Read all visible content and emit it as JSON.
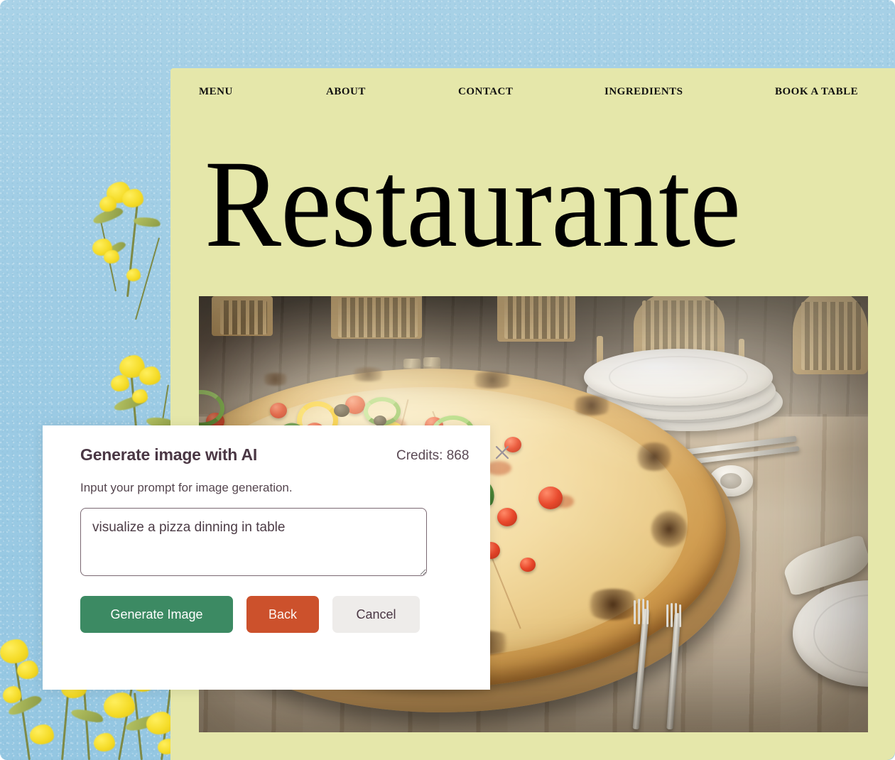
{
  "site": {
    "nav": [
      {
        "label": "MENU"
      },
      {
        "label": "ABOUT"
      },
      {
        "label": "CONTACT"
      },
      {
        "label": "INGREDIENTS"
      },
      {
        "label": "BOOK A TABLE"
      }
    ],
    "hero_title": "Restaurante",
    "hero_image_alt": "Pizza with peppers, cherry tomatoes, olives and basil on a wooden board set on a rustic wooden dining table with plates, cutlery and salt and pepper shakers",
    "background_alt": "Yellow wildflowers against a bright blue sky"
  },
  "dialog": {
    "title": "Generate image with AI",
    "credits_label": "Credits: 868",
    "credits_value": 868,
    "close_icon": "close-icon",
    "subtitle": "Input your prompt for image generation.",
    "prompt_value": "visualize a pizza dinning in table",
    "prompt_placeholder": "",
    "buttons": {
      "generate": "Generate Image",
      "back": "Back",
      "cancel": "Cancel"
    }
  },
  "colors": {
    "page_background": "#e5e7aa",
    "backdrop_sky": "#9ccbe4",
    "flower_yellow": "#f5dc28",
    "dialog_background": "#ffffff",
    "heading_text": "#4a3744",
    "generate_button": "#3c8a63",
    "back_button": "#cc512c",
    "cancel_button": "#eeecea",
    "close_icon": "#9b9299"
  }
}
